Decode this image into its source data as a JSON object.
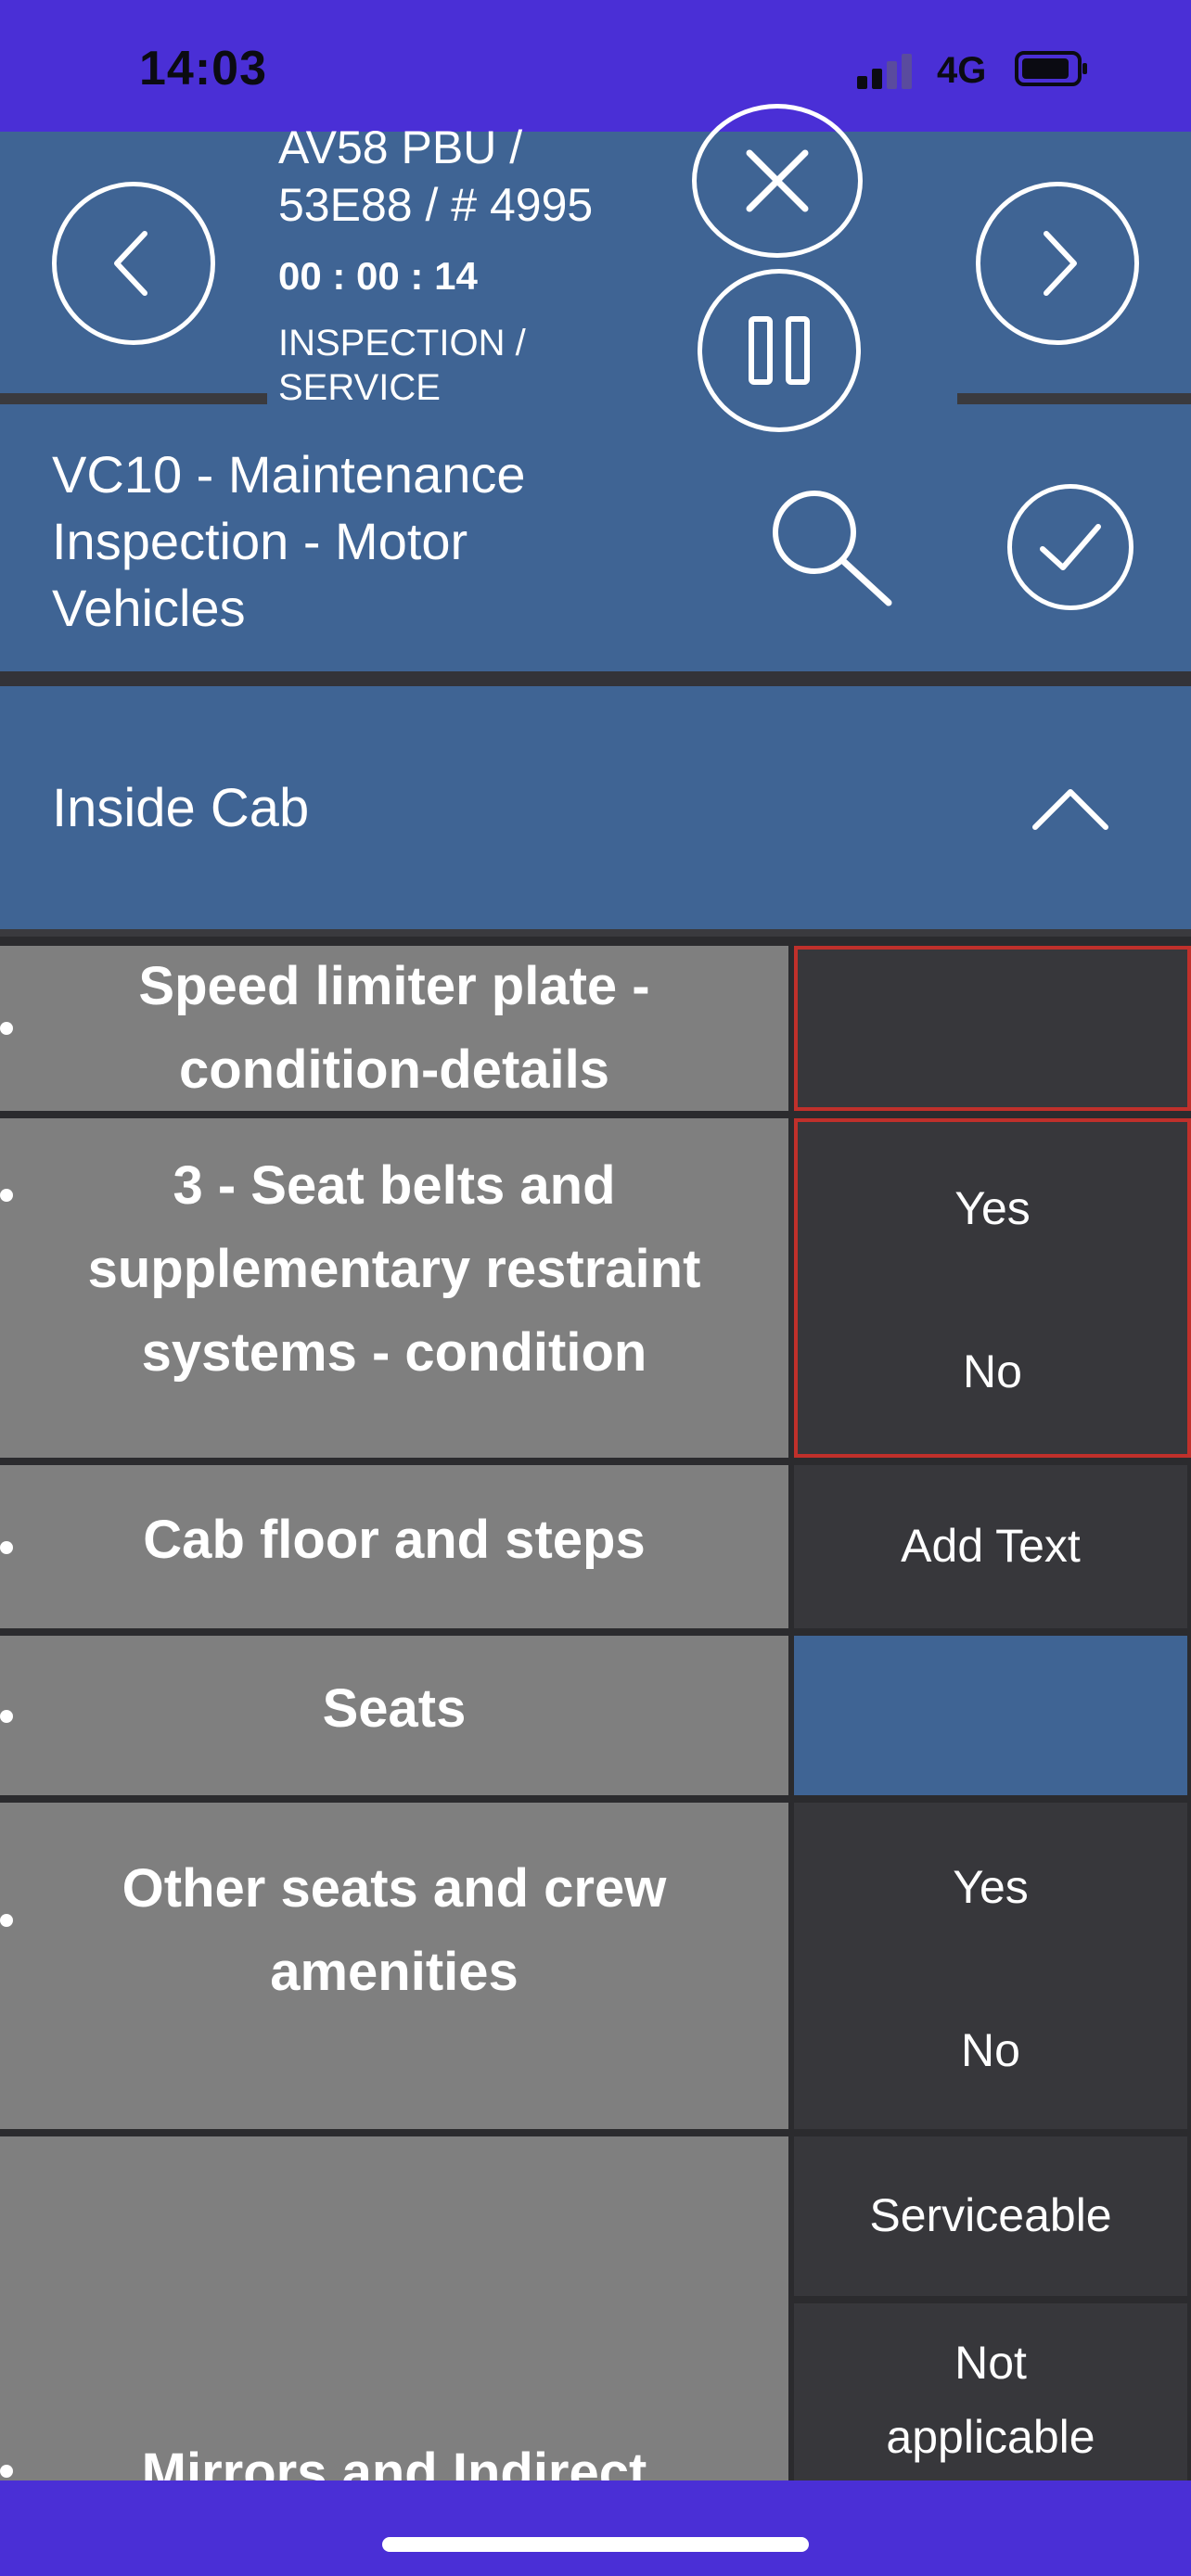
{
  "status_bar": {
    "time": "14:03",
    "network": "4G"
  },
  "header": {
    "vehicle_line1": "AV58 PBU /",
    "vehicle_line2": "53E88 / # 4995",
    "timer": "00 : 00 : 14",
    "type_line1": "INSPECTION /",
    "type_line2": "SERVICE",
    "form_title_line1": "VC10 - Maintenance",
    "form_title_line2": "Inspection - Motor",
    "form_title_line3": "Vehicles"
  },
  "section": {
    "title": "Inside Cab"
  },
  "items": [
    {
      "label_line1": "Speed limiter plate -",
      "label_line2": "condition-details"
    },
    {
      "label_line1": "3 - Seat belts and",
      "label_line2": "supplementary restraint",
      "label_line3": "systems - condition",
      "opt_yes": "Yes",
      "opt_no": "No"
    },
    {
      "label_line1": "Cab floor and steps",
      "action": "Add Text"
    },
    {
      "label_line1": "Seats"
    },
    {
      "label_line1": "Other seats and crew",
      "label_line2": "amenities",
      "opt_yes": "Yes",
      "opt_no": "No"
    },
    {
      "label_line1": "Mirrors and Indirect",
      "opt1": "Serviceable",
      "opt2_line1": "Not",
      "opt2_line2": "applicable"
    }
  ],
  "colors": {
    "status_bar": "#4a2fd6",
    "header": "#3f6494",
    "row_label_bg": "#7f7f7f",
    "row_value_bg": "#37373b",
    "required_border": "#c0302b"
  }
}
